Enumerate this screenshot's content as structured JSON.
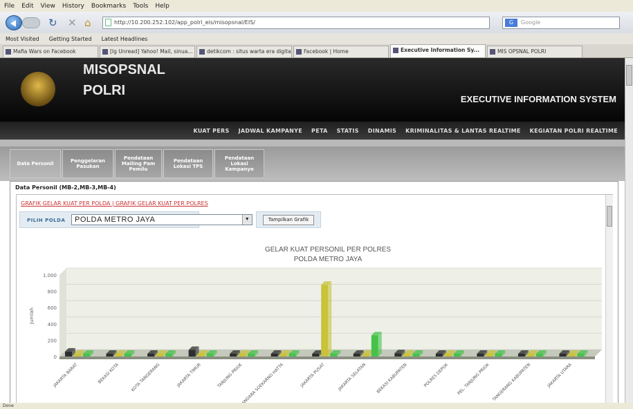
{
  "browser": {
    "menu": [
      "File",
      "Edit",
      "View",
      "History",
      "Bookmarks",
      "Tools",
      "Help"
    ],
    "url": "http://10.200.252.102/app_polri_eis/misopsnal/EIS/",
    "search_placeholder": "Google",
    "bookmarks": [
      "Most Visited",
      "Getting Started",
      "Latest Headlines"
    ],
    "tabs": [
      {
        "label": "Mafia Wars on Facebook"
      },
      {
        "label": "[Ig Unread] Yahoo! Mail, sinua..."
      },
      {
        "label": "detikcom : situs warta era digital"
      },
      {
        "label": "Facebook | Home"
      },
      {
        "label": "Executive Information Sy..."
      },
      {
        "label": "MIS OPSNAL POLRI"
      }
    ],
    "status": "Done"
  },
  "header": {
    "title_line1": "MISOPSNAL",
    "title_line2": "POLRI",
    "system": "EXECUTIVE INFORMATION SYSTEM"
  },
  "topnav": [
    "KUAT PERS",
    "JADWAL KAMPANYE",
    "PETA",
    "STATIS",
    "DINAMIS",
    "KRIMINALITAS & LANTAS REALTIME",
    "KEGIATAN POLRI REALTIME"
  ],
  "subtabs": [
    {
      "label": "Data Personil"
    },
    {
      "label": "Penggelaran Pasukan"
    },
    {
      "label": "Pendataan Mailing Pam Pemilu"
    },
    {
      "label": "Pendataan Lokasi TPS"
    },
    {
      "label": "Pendataan Lokasi Kampanye"
    }
  ],
  "content": {
    "title": "Data Personil (MB-2,MB-3,MB-4)",
    "link1": "GRAFIK GELAR KUAT PER POLDA",
    "link_sep": " | ",
    "link2": "GRAFIK GELAR KUAT PER POLRES",
    "pilih_label": "PILIH POLDA",
    "pilih_value": "POLDA METRO JAYA",
    "button_label": "Tampilkan Grafik"
  },
  "chart_data": {
    "type": "bar",
    "title": "GELAR KUAT PERSONIL PER POLRES",
    "subtitle": "POLDA METRO JAYA",
    "ylabel": "Jumlah",
    "yticks": [
      "0",
      "200",
      "400",
      "600",
      "800",
      "1.000"
    ],
    "ylim": [
      0,
      1000
    ],
    "categories": [
      "JAKARTA BARAT",
      "BEKASI KOTA",
      "KOTA TANGERANG",
      "JAKARTA TIMUR",
      "TANJUNG PRIOK",
      "BANDARA SOEKARNO HATTA",
      "JAKARTA PUSAT",
      "JAKARTA SELATAN",
      "BEKASI KABUPATEN",
      "POLRES DEPOK",
      "PEL. TANJUNG PRIOK",
      "TANGERANG KABUPATEN",
      "JAKARTA UTARA"
    ],
    "series": [
      {
        "name": "MB-2",
        "color": "#2e2e2e",
        "values": [
          60,
          0,
          0,
          80,
          0,
          0,
          0,
          0,
          40,
          0,
          0,
          0,
          0
        ]
      },
      {
        "name": "MB-3",
        "color": "#c9c23a",
        "values": [
          0,
          0,
          0,
          0,
          0,
          0,
          880,
          0,
          0,
          0,
          0,
          0,
          0
        ]
      },
      {
        "name": "MB-4",
        "color": "#46c24a",
        "values": [
          0,
          0,
          0,
          0,
          0,
          0,
          0,
          260,
          0,
          0,
          0,
          0,
          0
        ]
      }
    ]
  }
}
